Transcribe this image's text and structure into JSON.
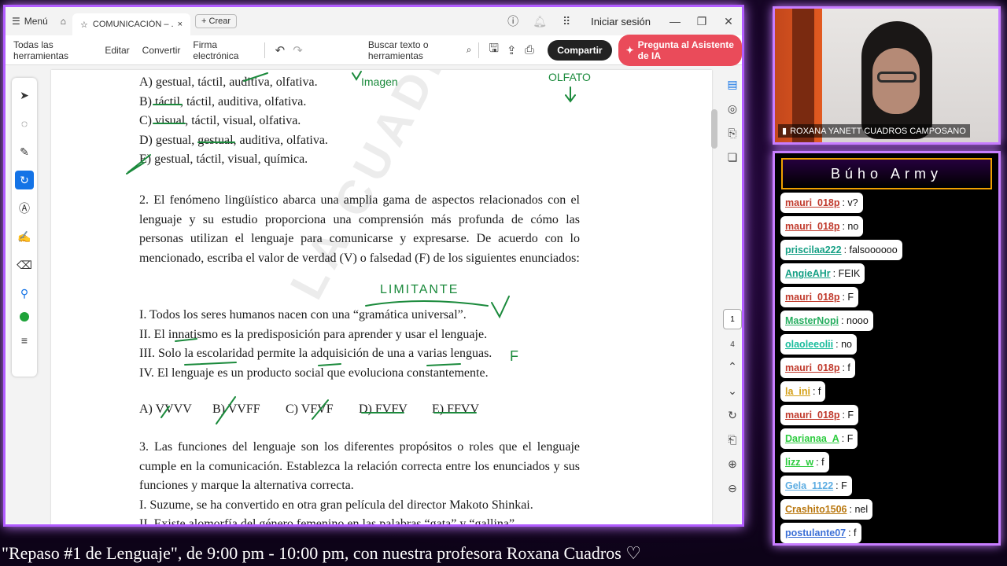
{
  "titlebar": {
    "menu_label": "Menú",
    "tab_title": "COMUNICACIÓN – ...",
    "new_label": "Crear",
    "signin": "Iniciar sesión"
  },
  "toolbar": {
    "all_tools": "Todas las herramientas",
    "edit": "Editar",
    "convert": "Convertir",
    "esign": "Firma electrónica",
    "search": "Buscar texto o herramientas",
    "share": "Compartir",
    "ai": "Pregunta al Asistente de IA"
  },
  "doc": {
    "q1_a": "A) gestual, táctil, auditiva, olfativa.",
    "q1_b": "B) táctil, táctil, auditiva, olfativa.",
    "q1_c": "C) visual, táctil, visual, olfativa.",
    "q1_d": "D) gestual, gestual, auditiva, olfativa.",
    "q1_e": "E) gestual, táctil, visual, química.",
    "q2": "2. El fenómeno lingüístico abarca una amplia gama de aspectos relacionados con el lenguaje y su estudio proporciona una comprensión más profunda de cómo las personas utilizan el lenguaje para comunicarse y expresarse. De acuerdo con lo mencionado, escriba el valor de verdad (V) o falsedad (F) de los siguientes enunciados:",
    "s1": "I.  Todos los seres humanos nacen con una “gramática universal”.",
    "s2": "II.  El innatismo es la predisposición para aprender y usar el lenguaje.",
    "s3": "III.  Solo la escolaridad permite la adquisición de una a varias lenguas.",
    "s4": "IV.  El lenguaje es un producto social que evoluciona constantemente.",
    "opt_a": "A) VVVV",
    "opt_b": "B) VVFF",
    "opt_c": "C) VFVF",
    "opt_d": "D) FVFV",
    "opt_e": "E) FFVV",
    "q3": "3. Las funciones del lenguaje son los diferentes propósitos o roles que el lenguaje cumple en la comunicación. Establezca la relación correcta entre los enunciados y sus funciones y marque la alternativa correcta.",
    "q3_i": "I.  Suzume, se ha convertido en otra gran película del director Makoto Shinkai.",
    "q3_ii": "II.  Existe alomorfía del género femenino en las palabras “gata” y “gallina”.",
    "handwriting_1": "LIMITANTE",
    "handwriting_2": "OLFATO",
    "handwriting_3": "Imagen",
    "watermark": "LA CUADROS"
  },
  "pager": {
    "current": "1",
    "total": "4"
  },
  "webcam": {
    "name": "ROXANA YANETT CUADROS CAMPOSANO"
  },
  "chat": {
    "title": "Búho Army",
    "messages": [
      {
        "user": "mauri_018p",
        "text": ": v?",
        "color": "#c0392b"
      },
      {
        "user": "mauri_018p",
        "text": ": no",
        "color": "#c0392b"
      },
      {
        "user": "priscilaa222",
        "text": ": falsoooooo",
        "color": "#16a085"
      },
      {
        "user": "AngieAHr",
        "text": ": FEIK",
        "color": "#16a085"
      },
      {
        "user": "mauri_018p",
        "text": ": F",
        "color": "#c0392b"
      },
      {
        "user": "MasterNopi",
        "text": ": nooo",
        "color": "#27ae60"
      },
      {
        "user": "olaoleeolii",
        "text": ": no",
        "color": "#1abc9c"
      },
      {
        "user": "mauri_018p",
        "text": ": f",
        "color": "#c0392b"
      },
      {
        "user": "la_ini",
        "text": ": f",
        "color": "#d4a017"
      },
      {
        "user": "mauri_018p",
        "text": ": F",
        "color": "#c0392b"
      },
      {
        "user": "Darianaa_A",
        "text": ": F",
        "color": "#2ecc40"
      },
      {
        "user": "lizz_w",
        "text": ": f",
        "color": "#2ecc40"
      },
      {
        "user": "Gela_1122",
        "text": ": F",
        "color": "#5dade2"
      },
      {
        "user": "Crashito1506",
        "text": ": nel",
        "color": "#b9770e"
      },
      {
        "user": "postulante07",
        "text": ": f",
        "color": "#3b6fd6"
      }
    ]
  },
  "ticker": "\"Repaso #1 de Lenguaje\", de 9:00 pm - 10:00 pm, con nuestra profesora Roxana Cuadros ♡"
}
